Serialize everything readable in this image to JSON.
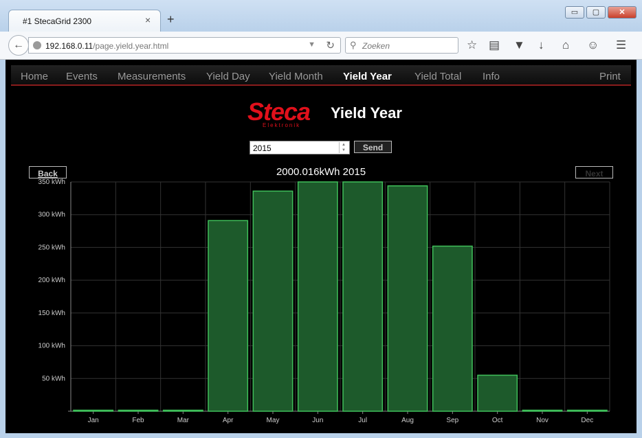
{
  "browser": {
    "tab_title": "#1 StecaGrid 2300",
    "tab_close": "×",
    "new_tab": "+",
    "url_host": "192.168.0.11",
    "url_path": "/page.yield.year.html",
    "search_placeholder": "Zoeken",
    "window_buttons": {
      "minimize": "▭",
      "maximize": "▢",
      "close": "✕"
    }
  },
  "menu": {
    "items": [
      {
        "label": "Home",
        "active": false
      },
      {
        "label": "Events",
        "active": false
      },
      {
        "label": "Measurements",
        "active": false
      },
      {
        "label": "Yield Day",
        "active": false
      },
      {
        "label": "Yield Month",
        "active": false
      },
      {
        "label": "Yield Year",
        "active": true
      },
      {
        "label": "Yield Total",
        "active": false
      },
      {
        "label": "Info",
        "active": false
      }
    ],
    "print_label": "Print"
  },
  "logo": {
    "brand": "Steca",
    "sub": "Elektronik"
  },
  "page_title": "Yield Year",
  "form": {
    "year_value": "2015",
    "send_label": "Send"
  },
  "nav": {
    "back_label": "Back",
    "next_label": "Next"
  },
  "colors": {
    "bar_fill": "#1d5a2b",
    "bar_stroke": "#3fbf5a",
    "grid": "#333333",
    "accent_red": "#e0101b"
  },
  "chart_data": {
    "type": "bar",
    "title": "2000.016kWh 2015",
    "categories": [
      "Jan",
      "Feb",
      "Mar",
      "Apr",
      "May",
      "Jun",
      "Jul",
      "Aug",
      "Sep",
      "Oct",
      "Nov",
      "Dec"
    ],
    "values": [
      0,
      0,
      0,
      291,
      336,
      350,
      350,
      344,
      252,
      55,
      0,
      0
    ],
    "ylim": [
      0,
      350
    ],
    "yticks": [
      50,
      100,
      150,
      200,
      250,
      300,
      350
    ],
    "ytick_labels": [
      "50 kWh",
      "100 kWh",
      "150 kWh",
      "200 kWh",
      "250 kWh",
      "300 kWh",
      "350 kWh"
    ],
    "grid": true
  }
}
